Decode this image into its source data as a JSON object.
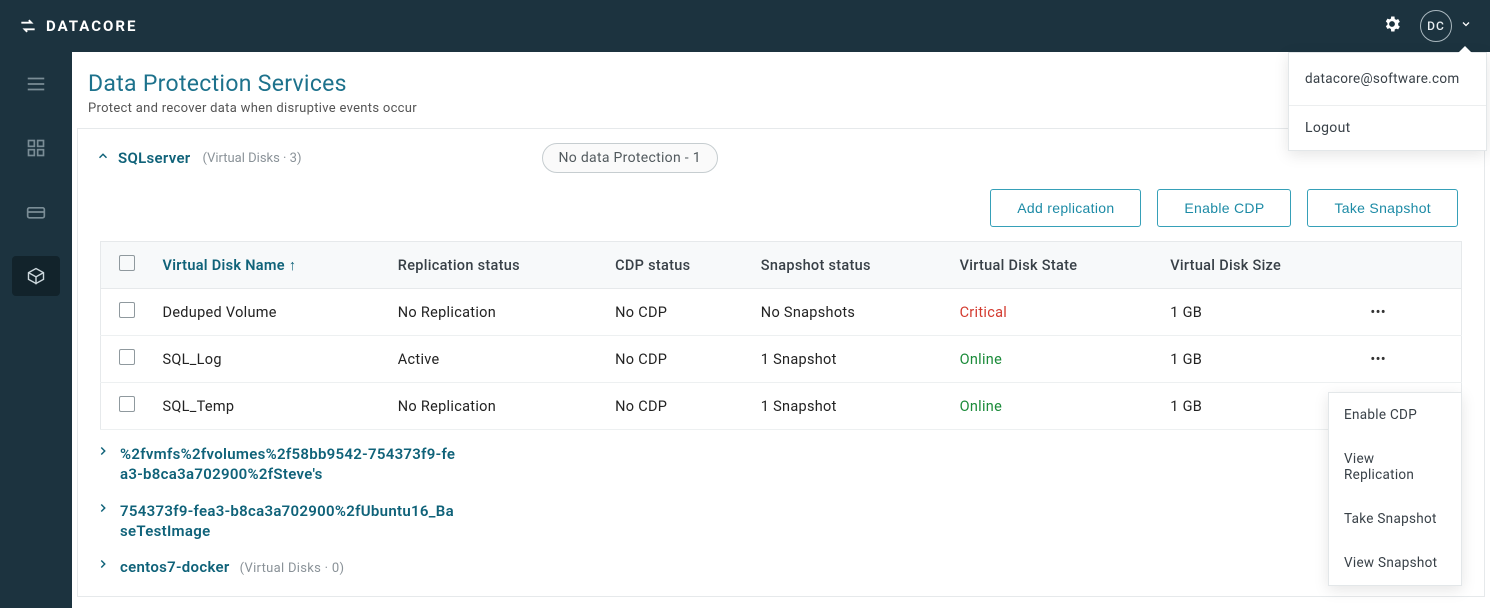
{
  "brand": "DATACORE",
  "avatar_initials": "DC",
  "page": {
    "title": "Data Protection Services",
    "subtitle": "Protect and recover data when disruptive events occur"
  },
  "group": {
    "name": "SQLserver",
    "meta": "(Virtual Disks · 3)",
    "pill": "No data Protection - 1"
  },
  "actions": {
    "add_replication": "Add replication",
    "enable_cdp": "Enable CDP",
    "take_snapshot": "Take Snapshot"
  },
  "columns": {
    "name": "Virtual Disk Name",
    "replication": "Replication status",
    "cdp": "CDP status",
    "snapshot": "Snapshot status",
    "state": "Virtual Disk State",
    "size": "Virtual Disk Size"
  },
  "rows": [
    {
      "name": "Deduped Volume",
      "replication": "No Replication",
      "cdp": "No CDP",
      "snapshot": "No Snapshots",
      "state": "Critical",
      "state_cls": "state-crit",
      "size": "1 GB"
    },
    {
      "name": "SQL_Log",
      "replication": "Active",
      "cdp": "No CDP",
      "snapshot": "1 Snapshot",
      "state": "Online",
      "state_cls": "state-ok",
      "size": "1 GB"
    },
    {
      "name": "SQL_Temp",
      "replication": "No Replication",
      "cdp": "No CDP",
      "snapshot": "1 Snapshot",
      "state": "Online",
      "state_cls": "state-ok",
      "size": "1 GB"
    }
  ],
  "subgroups": [
    {
      "name": "%2fvmfs%2fvolumes%2f58bb9542-754373f9-fea3-b8ca3a702900%2fSteve's",
      "meta": ""
    },
    {
      "name": "754373f9-fea3-b8ca3a702900%2fUbuntu16_BaseTestImage",
      "meta": ""
    },
    {
      "name": "centos7-docker",
      "meta": "(Virtual Disks · 0)"
    }
  ],
  "user_menu": {
    "email": "datacore@software.com",
    "logout": "Logout"
  },
  "ctx_menu": {
    "enable_cdp": "Enable CDP",
    "view_replication": "View Replication",
    "take_snapshot": "Take Snapshot",
    "view_snapshot": "View Snapshot"
  }
}
